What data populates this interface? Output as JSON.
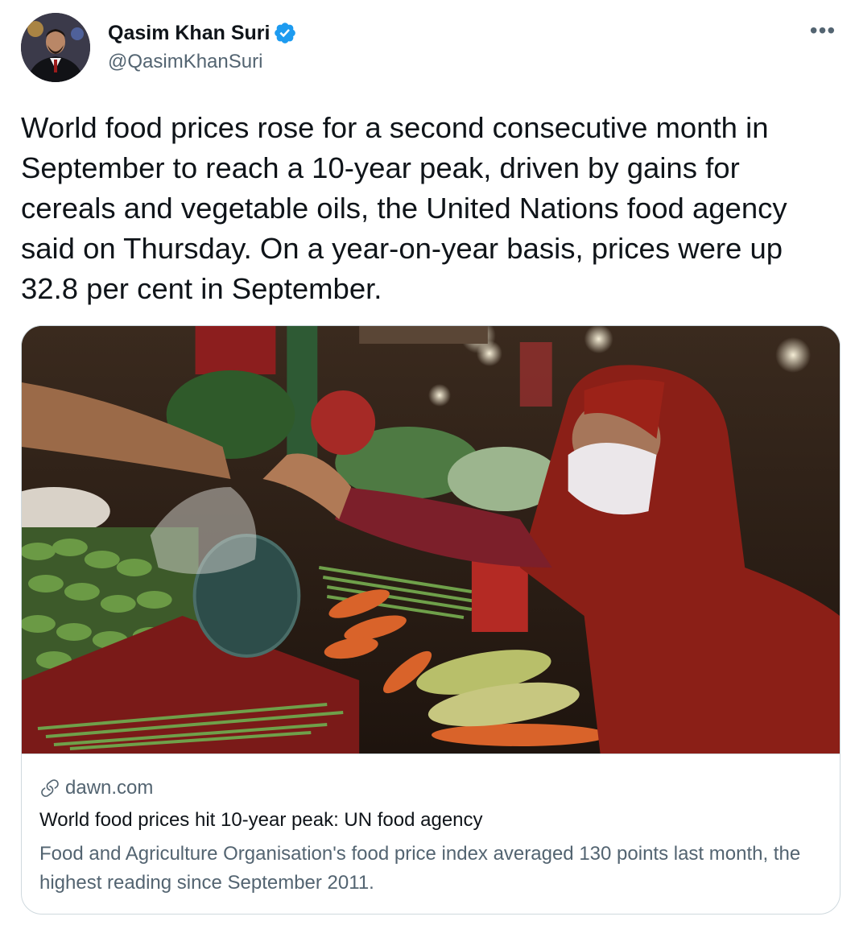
{
  "tweet": {
    "author": {
      "display_name": "Qasim Khan Suri",
      "handle": "@QasimKhanSuri",
      "verified": true
    },
    "more_icon": "more-horizontal-icon",
    "text": "World food prices rose for a second consecutive month in September to reach a 10-year peak, driven by gains for cereals and vegetable oils, the United Nations food agency said on Thursday. On a year-on-year basis, prices were up 32.8 per cent in September.",
    "card": {
      "link_icon": "link-icon",
      "domain": "dawn.com",
      "title": "World food prices hit 10-year peak: UN food agency",
      "description": "Food and Agriculture Organisation's food price index averaged 130 points last month, the highest reading since September 2011."
    }
  },
  "colors": {
    "text_primary": "#0f1419",
    "text_secondary": "#536471",
    "verified_blue": "#1d9bf0",
    "border": "#cfd9de"
  }
}
